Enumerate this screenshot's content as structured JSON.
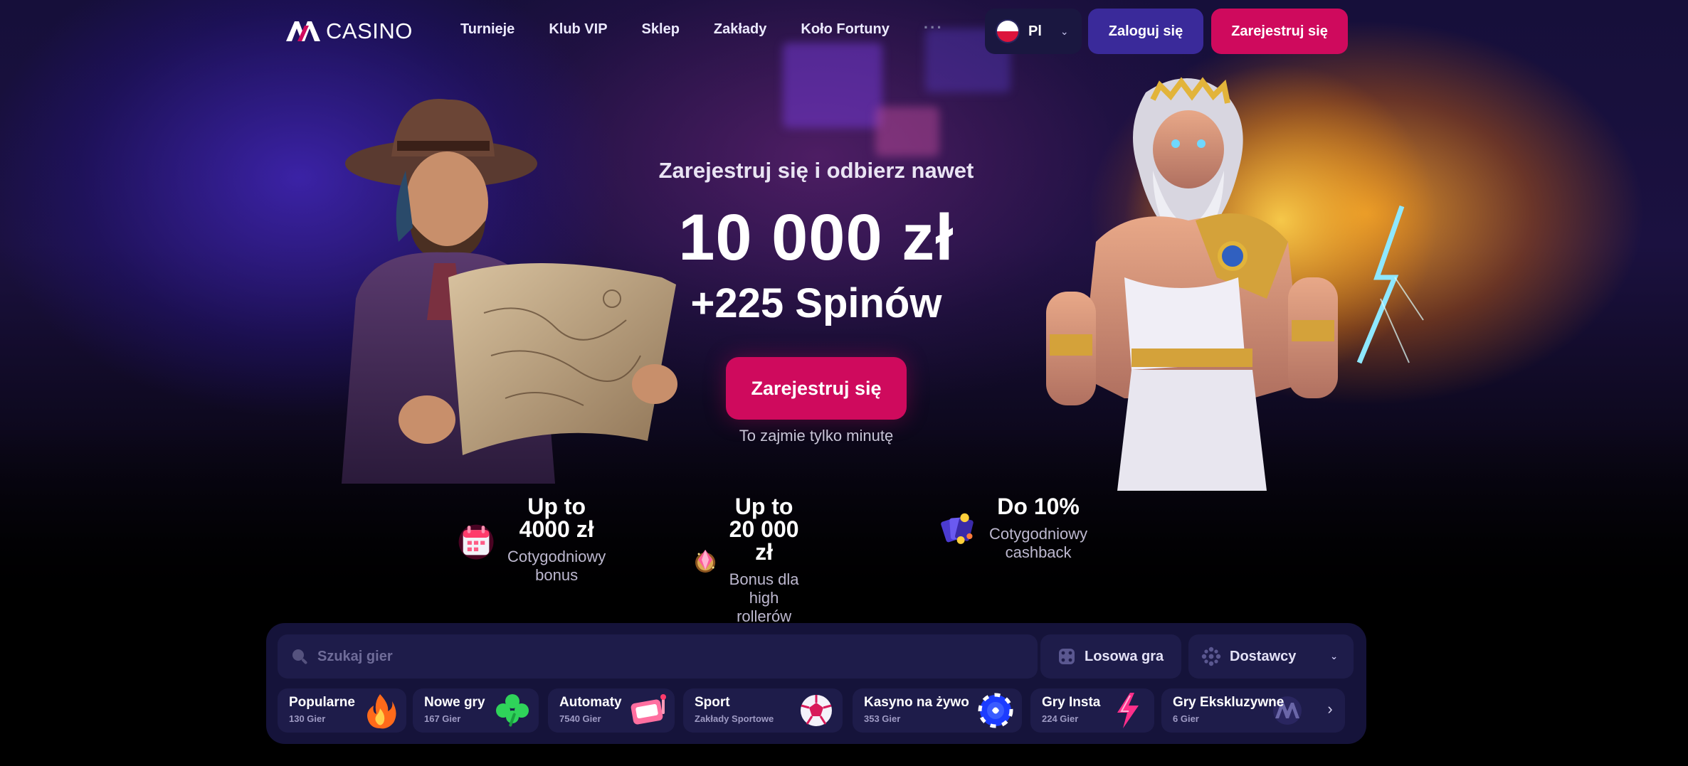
{
  "header": {
    "logo_text": "CASINO",
    "nav": [
      "Turnieje",
      "Klub VIP",
      "Sklep",
      "Zakłady",
      "Koło Fortuny"
    ],
    "more": "···",
    "language_code": "Pl",
    "login_label": "Zaloguj się",
    "register_label": "Zarejestruj się"
  },
  "hero": {
    "subtitle": "Zarejestruj się i odbierz nawet",
    "amount": "10 000 zł",
    "spins": "+225 Spinów",
    "cta_label": "Zarejestruj się",
    "note": "To zajmie tylko minutę"
  },
  "perks": [
    {
      "title": "Up to 4000 zł",
      "desc": "Cotygodniowy bonus",
      "icon": "calendar-icon"
    },
    {
      "title": "Up to 20 000 zł",
      "desc": "Bonus dla high rollerów",
      "icon": "diamond-icon"
    },
    {
      "title": "Do 10%",
      "desc": "Cotygodniowy cashback",
      "icon": "cards-icon"
    }
  ],
  "games": {
    "search_placeholder": "Szukaj gier",
    "random_label": "Losowa gra",
    "providers_label": "Dostawcy",
    "categories": [
      {
        "name": "Popularne",
        "count": "130 Gier",
        "icon": "fire-icon"
      },
      {
        "name": "Nowe gry",
        "count": "167 Gier",
        "icon": "clover-icon"
      },
      {
        "name": "Automaty",
        "count": "7540 Gier",
        "icon": "slot-machine-icon"
      },
      {
        "name": "Sport",
        "count": "Zakłady Sportowe",
        "icon": "soccer-ball-icon"
      },
      {
        "name": "Kasyno na żywo",
        "count": "353 Gier",
        "icon": "chip-icon"
      },
      {
        "name": "Gry Insta",
        "count": "224 Gier",
        "icon": "lightning-icon"
      },
      {
        "name": "Gry Ekskluzywne",
        "count": "6 Gier",
        "icon": "logo-icon"
      }
    ]
  },
  "colors": {
    "accent_pink": "#cf0a5d",
    "login_purple": "#3a2a9a",
    "panel_bg": "#15133a",
    "control_bg": "#1e1c4a"
  }
}
